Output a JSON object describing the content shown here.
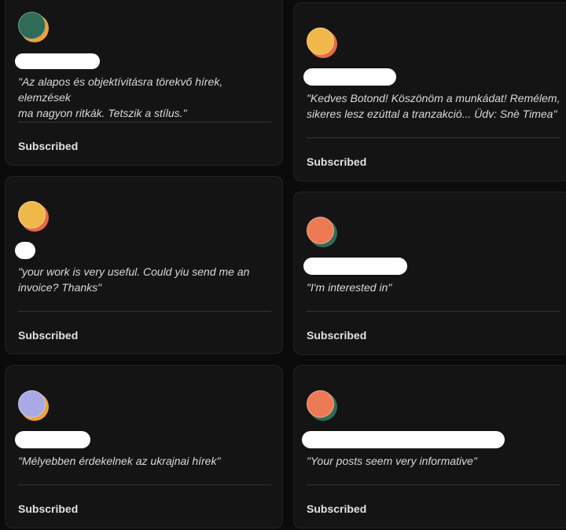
{
  "cards": [
    {
      "avatar": {
        "icon": "subscriber-avatar-icon",
        "front": "#2f6b57",
        "back": "#f0a23a"
      },
      "quote": "\"Az alapos és objektívitásra törekvő hírek, elemzések\nma nagyon ritkák. Tetszik a stílus.\"",
      "status": "Subscribed"
    },
    {
      "avatar": {
        "icon": "subscriber-avatar-icon",
        "front": "#f0b84a",
        "back": "#e56a45"
      },
      "quote": "\"Kedves Botond! Köszönöm a munkádat! Remélem,\nsikeres lesz ezúttal a tranzakció... Üdv: Snè Timea\"",
      "status": "Subscribed"
    },
    {
      "avatar": {
        "icon": "subscriber-avatar-icon",
        "front": "#f0b84a",
        "back": "#e56a45"
      },
      "quote": "\"your work is very useful. Could yiu send me an\ninvoice? Thanks\"",
      "status": "Subscribed"
    },
    {
      "avatar": {
        "icon": "subscriber-avatar-icon",
        "front": "#ee7a55",
        "back": "#2f6b57"
      },
      "quote": "\"I'm interested in\"",
      "status": "Subscribed"
    },
    {
      "avatar": {
        "icon": "subscriber-avatar-icon",
        "front": "#a9a9e6",
        "back": "#f0a23a"
      },
      "quote": "\"Mélyebben érdekelnek az ukrajnai hírek\"",
      "status": "Subscribed"
    },
    {
      "avatar": {
        "icon": "subscriber-avatar-icon",
        "front": "#ee7a55",
        "back": "#2f6b57"
      },
      "quote": "\"Your posts seem very informative\"",
      "status": "Subscribed"
    }
  ]
}
